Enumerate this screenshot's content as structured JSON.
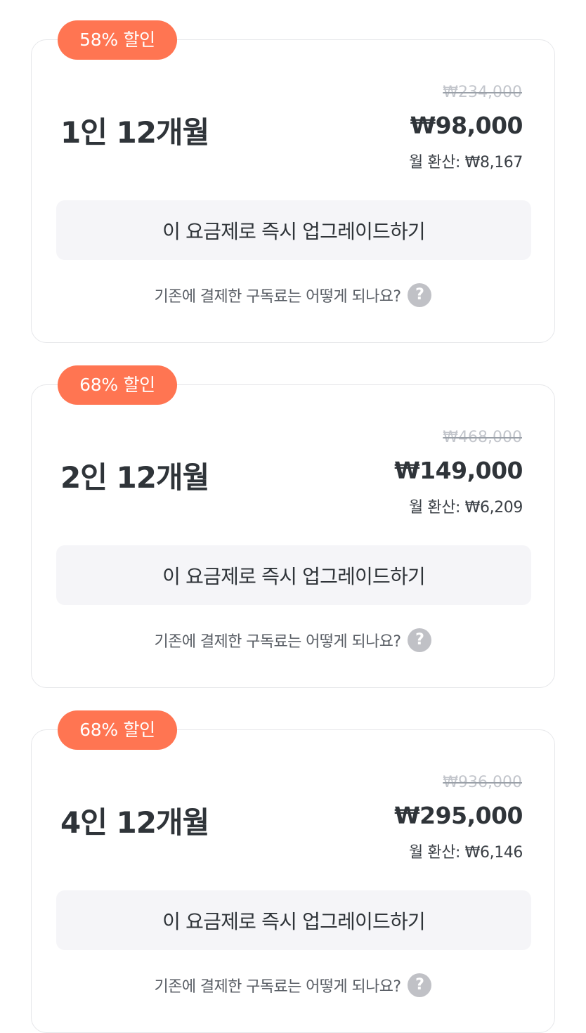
{
  "plans": [
    {
      "discount_badge": "58% 할인",
      "name": "1인 12개월",
      "original_price": "₩234,000",
      "price": "₩98,000",
      "monthly": "월 환산: ₩8,167",
      "upgrade_label": "이 요금제로 즉시 업그레이드하기",
      "faq_label": "기존에 결제한 구독료는 어떻게 되나요?",
      "help_icon": "?"
    },
    {
      "discount_badge": "68% 할인",
      "name": "2인 12개월",
      "original_price": "₩468,000",
      "price": "₩149,000",
      "monthly": "월 환산: ₩6,209",
      "upgrade_label": "이 요금제로 즉시 업그레이드하기",
      "faq_label": "기존에 결제한 구독료는 어떻게 되나요?",
      "help_icon": "?"
    },
    {
      "discount_badge": "68% 할인",
      "name": "4인 12개월",
      "original_price": "₩936,000",
      "price": "₩295,000",
      "monthly": "월 환산: ₩6,146",
      "upgrade_label": "이 요금제로 즉시 업그레이드하기",
      "faq_label": "기존에 결제한 구독료는 어떻게 되나요?",
      "help_icon": "?"
    }
  ],
  "colors": {
    "badge": "#ff7552",
    "button_bg": "#f5f5f8",
    "text": "#2f3439",
    "muted": "#c3c6cc",
    "help_icon": "#c0c1c6"
  }
}
